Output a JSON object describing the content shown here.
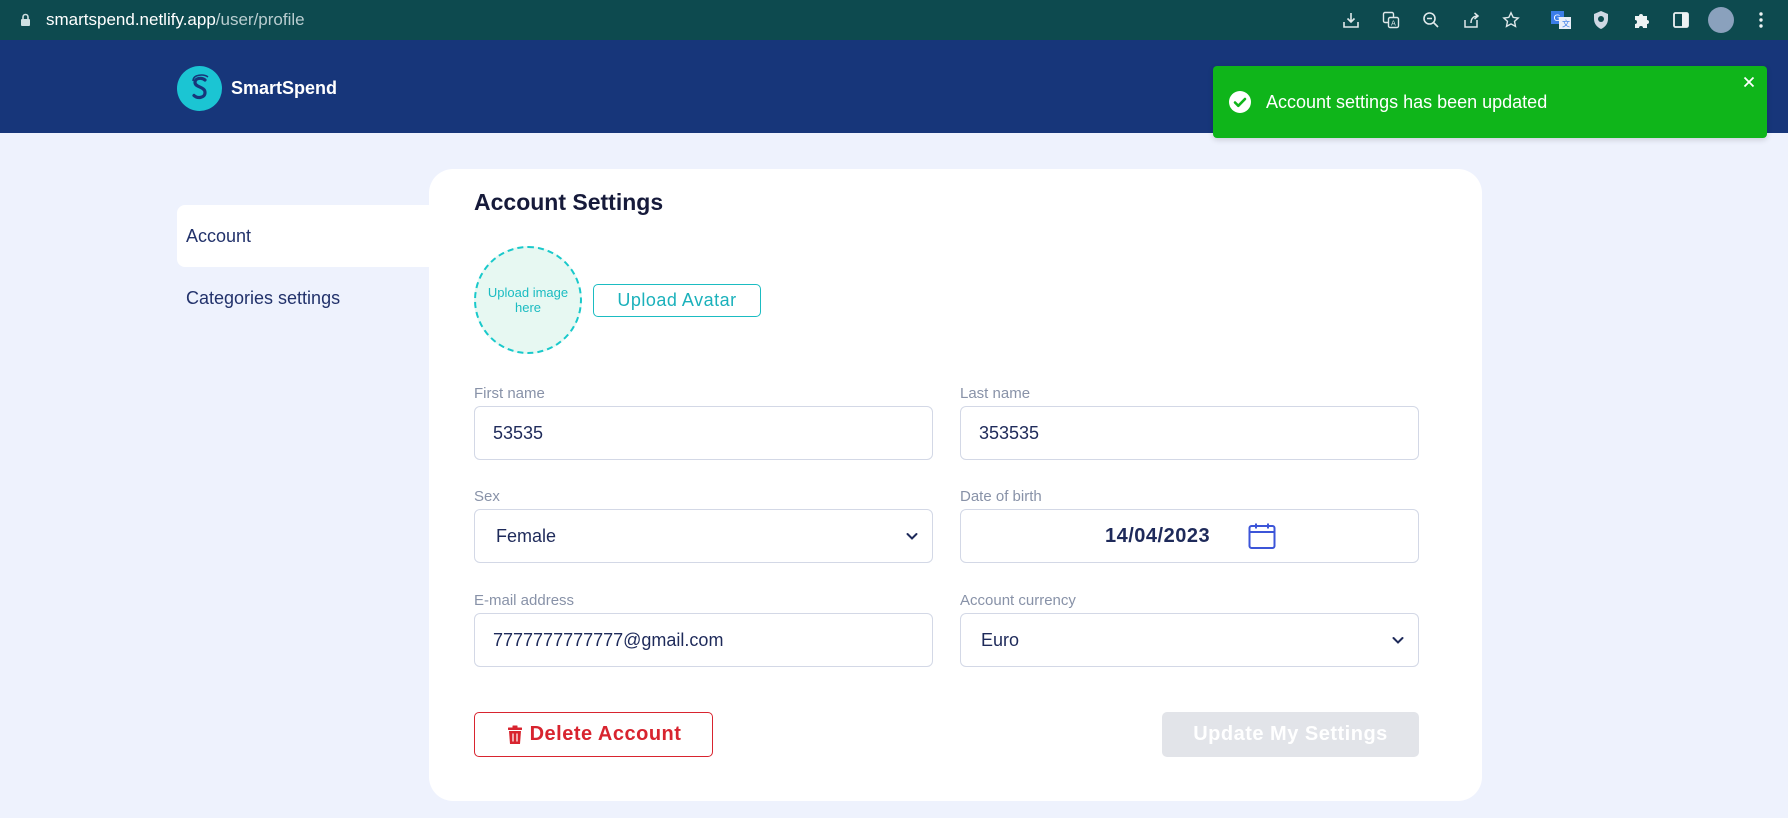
{
  "browser": {
    "url_host": "smartspend.netlify.app",
    "url_path": "/user/profile",
    "icons": [
      "lock-icon",
      "download-icon",
      "translate-icon",
      "zoom-icon",
      "share-icon",
      "star-icon",
      "extension-translate-icon",
      "shield-extension-icon",
      "puzzle-icon",
      "sidepanel-icon",
      "profile-avatar",
      "menu-kebab-icon"
    ]
  },
  "header": {
    "app_name": "SmartSpend",
    "logo_letter": "S",
    "colors": {
      "bar": "#17367a",
      "logo": "#1bc5d3"
    }
  },
  "toast": {
    "message": "Account settings has been updated",
    "color": "#0fb51a"
  },
  "sidebar": {
    "items": [
      {
        "label": "Account",
        "active": true
      },
      {
        "label": "Categories settings",
        "active": false
      }
    ]
  },
  "main": {
    "title": "Account Settings",
    "avatar": {
      "drop_text": "Upload image here",
      "button_label": "Upload Avatar"
    },
    "fields": {
      "first_name": {
        "label": "First name",
        "value": "53535"
      },
      "last_name": {
        "label": "Last name",
        "value": "353535"
      },
      "sex": {
        "label": "Sex",
        "value": "Female"
      },
      "dob": {
        "label": "Date of birth",
        "value": "14/04/2023"
      },
      "email": {
        "label": "E-mail address",
        "value": "7777777777777@gmail.com"
      },
      "currency": {
        "label": "Account currency",
        "value": "Euro"
      }
    },
    "actions": {
      "delete_label": "Delete Account",
      "update_label": "Update My Settings"
    },
    "colors": {
      "accent": "#1bbcc2",
      "danger": "#d8242f",
      "disabled": "#e2e4e9"
    }
  }
}
